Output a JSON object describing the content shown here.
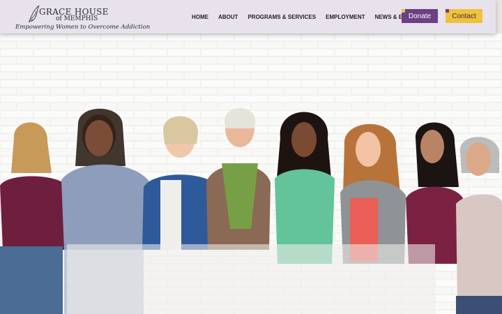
{
  "header": {
    "logo": {
      "name_line1": "GRACE HOUSE",
      "name_line2": "of MEMPHIS",
      "tagline": "Empowering Women to Overcome Addiction"
    },
    "nav": [
      {
        "label": "HOME"
      },
      {
        "label": "ABOUT"
      },
      {
        "label": "PROGRAMS & SERVICES"
      },
      {
        "label": "EMPLOYMENT"
      },
      {
        "label": "NEWS & EVENTS"
      }
    ],
    "donate_label": "Donate",
    "contact_label": "Contact"
  },
  "colors": {
    "header_bg": "#e7e2ec",
    "donate": "#6b4183",
    "contact": "#f0c13b"
  },
  "hero": {
    "image": "group-of-smiling-women-photo"
  }
}
